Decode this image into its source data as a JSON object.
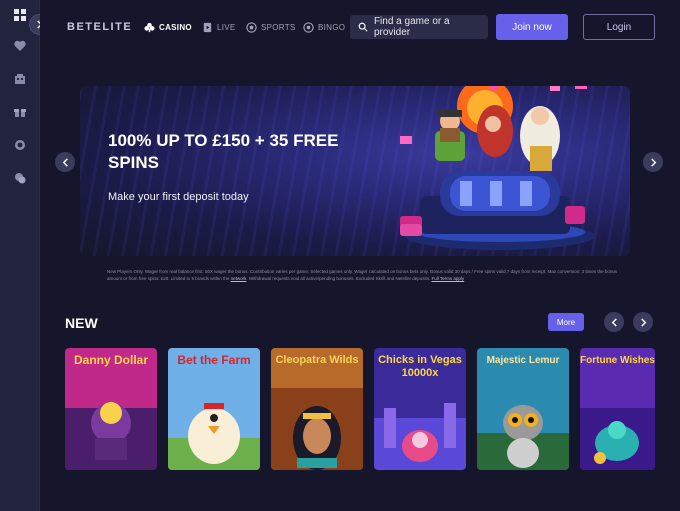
{
  "sidebar": {
    "toggle_icon": "chevron-right-icon",
    "items": [
      {
        "icon": "grid-icon"
      },
      {
        "icon": "heart-icon"
      },
      {
        "icon": "building-icon"
      },
      {
        "icon": "gift-icon"
      },
      {
        "icon": "coin-icon"
      },
      {
        "icon": "chat-icon"
      }
    ]
  },
  "header": {
    "logo": "BETELITE",
    "nav": [
      {
        "label": "CASINO",
        "icon": "clubs-icon",
        "active": true
      },
      {
        "label": "LIVE",
        "icon": "live-icon",
        "active": false
      },
      {
        "label": "SPORTS",
        "icon": "soccer-ball-icon",
        "active": false
      },
      {
        "label": "BINGO",
        "icon": "bingo-icon",
        "active": false
      }
    ],
    "search_label": "Find a game or a provider",
    "join_label": "Join now",
    "login_label": "Login"
  },
  "banner": {
    "title": "100% UP TO £150 + 35 FREE SPINS",
    "subtitle": "Make your first deposit today",
    "terms_text": "New Players Only. Wager from real balance first. 50X wager the bonus. Contribution varies per game. Selected games only. Wager calculated on bonus bets only. Bonus valid 30 days / Free spins valid 7 days from receipt. Max conversion: 3 times the bonus amount or from free spins: £20. Limited to 5 brands within the",
    "terms_link1": "network",
    "terms_text2": ". Withdrawal requests void all active/pending bonuses. Excluded Skrill and Neteller deposits.",
    "terms_link2": "Full Terms apply"
  },
  "new_section": {
    "title": "NEW",
    "more_label": "More",
    "games": [
      {
        "title": "Danny Dollar"
      },
      {
        "title": "Bet the Farm"
      },
      {
        "title": "Cleopatra Wilds"
      },
      {
        "title": "Chicks in Vegas 10000x"
      },
      {
        "title": "Majestic Lemur"
      },
      {
        "title": "Fortune Wishes"
      }
    ]
  },
  "colors": {
    "background": "#15162b",
    "sidebar": "#22233d",
    "accent": "#6760ea"
  }
}
